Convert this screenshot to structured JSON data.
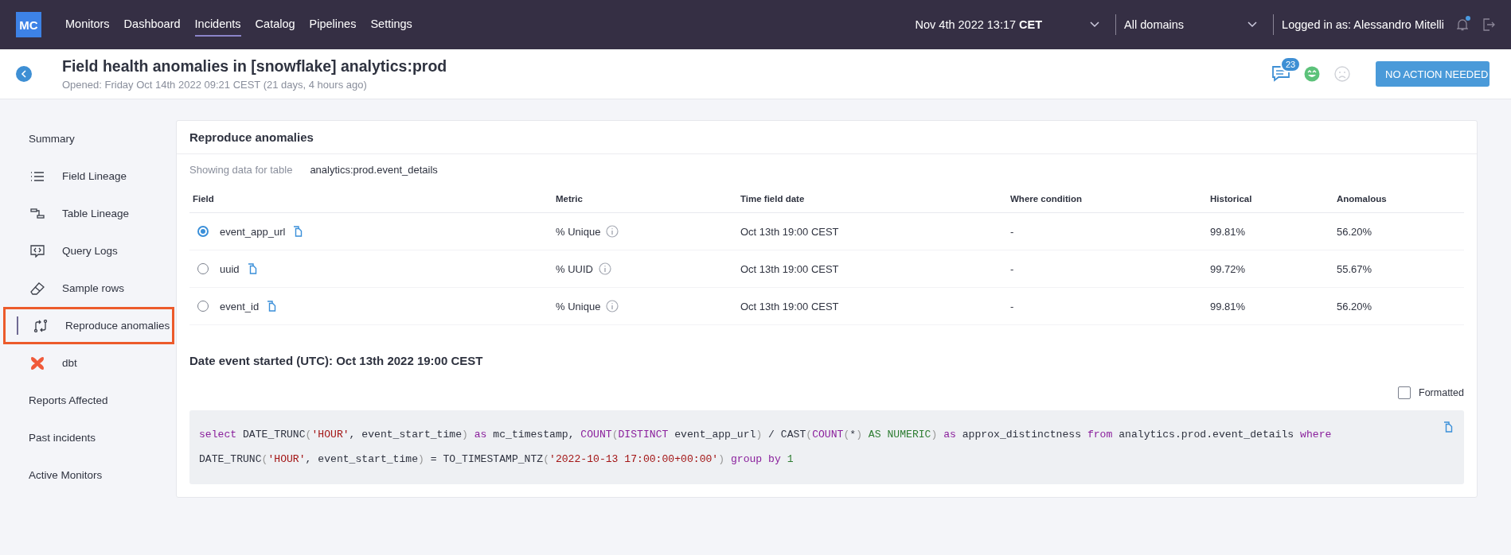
{
  "topbar": {
    "logo": "MC",
    "nav": [
      {
        "label": "Monitors",
        "selected": false
      },
      {
        "label": "Dashboard",
        "selected": false
      },
      {
        "label": "Incidents",
        "selected": true
      },
      {
        "label": "Catalog",
        "selected": false
      },
      {
        "label": "Pipelines",
        "selected": false
      },
      {
        "label": "Settings",
        "selected": false
      }
    ],
    "date": "Nov 4th 2022 13:17 **CET**",
    "domain": "All domains",
    "user": "Logged in as: Alessandro Mitelli",
    "notifications_unread": true
  },
  "header": {
    "title": "Field health anomalies in [snowflake] analytics:prod",
    "subtitle": "Opened: Friday Oct 14th 2022 09:21 CEST (21 days, 4 hours ago)",
    "comment_count": "23",
    "status_button": "NO ACTION NEEDED"
  },
  "sidebar": {
    "items": [
      {
        "kind": "section",
        "label": "Summary",
        "selected": false,
        "highlighted": false
      },
      {
        "kind": "link",
        "label": "Field Lineage",
        "selected": false,
        "highlighted": false
      },
      {
        "kind": "link",
        "label": "Table Lineage",
        "selected": false,
        "highlighted": false
      },
      {
        "kind": "link",
        "label": "Query Logs",
        "selected": false,
        "highlighted": false
      },
      {
        "kind": "link",
        "label": "Sample rows",
        "selected": false,
        "highlighted": false
      },
      {
        "kind": "link",
        "label": "Reproduce anomalies",
        "selected": true,
        "highlighted": true
      },
      {
        "kind": "link",
        "label": "dbt",
        "selected": false,
        "highlighted": false
      },
      {
        "kind": "section",
        "label": "Reports Affected",
        "selected": false,
        "highlighted": false
      },
      {
        "kind": "section",
        "label": "Past incidents",
        "selected": false,
        "highlighted": false
      },
      {
        "kind": "section",
        "label": "Active Monitors",
        "selected": false,
        "highlighted": false
      }
    ]
  },
  "panel": {
    "title": "Reproduce anomalies",
    "table_label": "Showing data for table",
    "table_name": "analytics:prod.event_details",
    "table": {
      "columns": [
        "Field",
        "Metric",
        "Time field date",
        "Where condition",
        "Historical",
        "Anomalous"
      ],
      "rows": [
        {
          "selected": true,
          "field": "event_app_url",
          "metric": "% Unique",
          "time": "Oct 13th 19:00 CEST",
          "where": "-",
          "historical": "99.81%",
          "anomalous": "56.20%"
        },
        {
          "selected": false,
          "field": "uuid",
          "metric": "% UUID",
          "time": "Oct 13th 19:00 CEST",
          "where": "-",
          "historical": "99.72%",
          "anomalous": "55.67%"
        },
        {
          "selected": false,
          "field": "event_id",
          "metric": "% Unique",
          "time": "Oct 13th 19:00 CEST",
          "where": "-",
          "historical": "99.81%",
          "anomalous": "56.20%"
        }
      ]
    },
    "date_heading": "Date event started (UTC): Oct 13th 2022 19:00 CEST",
    "formatted": {
      "label": "Formatted",
      "checked": false
    },
    "code": [
      {
        "kind": "keyword",
        "text": "select"
      },
      {
        "kind": "plain",
        "text": " DATE_TRUNC"
      },
      {
        "kind": "punct",
        "text": "("
      },
      {
        "kind": "string",
        "text": "'HOUR'"
      },
      {
        "kind": "plain",
        "text": ", event_start_time"
      },
      {
        "kind": "punct",
        "text": ")"
      },
      {
        "kind": "keyword",
        "text": " as"
      },
      {
        "kind": "plain",
        "text": " mc_timestamp, "
      },
      {
        "kind": "keyword",
        "text": "COUNT"
      },
      {
        "kind": "punct",
        "text": "("
      },
      {
        "kind": "keyword",
        "text": "DISTINCT"
      },
      {
        "kind": "plain",
        "text": " event_app_url"
      },
      {
        "kind": "punct",
        "text": ")"
      },
      {
        "kind": "plain",
        "text": " / CAST"
      },
      {
        "kind": "punct",
        "text": "("
      },
      {
        "kind": "keyword",
        "text": "COUNT"
      },
      {
        "kind": "punct",
        "text": "("
      },
      {
        "kind": "plain",
        "text": "*"
      },
      {
        "kind": "punct",
        "text": ")"
      },
      {
        "kind": "type",
        "text": " AS NUMERIC"
      },
      {
        "kind": "punct",
        "text": ")"
      },
      {
        "kind": "keyword",
        "text": " as"
      },
      {
        "kind": "plain",
        "text": " approx_distinctness "
      },
      {
        "kind": "keyword",
        "text": "from"
      },
      {
        "kind": "plain",
        "text": " analytics.prod.event_details "
      },
      {
        "kind": "keyword",
        "text": "where"
      },
      {
        "kind": "plain",
        "text": " DATE_TRUNC"
      },
      {
        "kind": "punct",
        "text": "("
      },
      {
        "kind": "string",
        "text": "'HOUR'"
      },
      {
        "kind": "plain",
        "text": ", event_start_time"
      },
      {
        "kind": "punct",
        "text": ")"
      },
      {
        "kind": "plain",
        "text": " = TO_TIMESTAMP_NTZ"
      },
      {
        "kind": "punct",
        "text": "("
      },
      {
        "kind": "string",
        "text": "'2022-10-13 17:00:00+00:00'"
      },
      {
        "kind": "punct",
        "text": ")"
      },
      {
        "kind": "keyword",
        "text": " group by"
      },
      {
        "kind": "number",
        "text": " 1"
      }
    ]
  }
}
